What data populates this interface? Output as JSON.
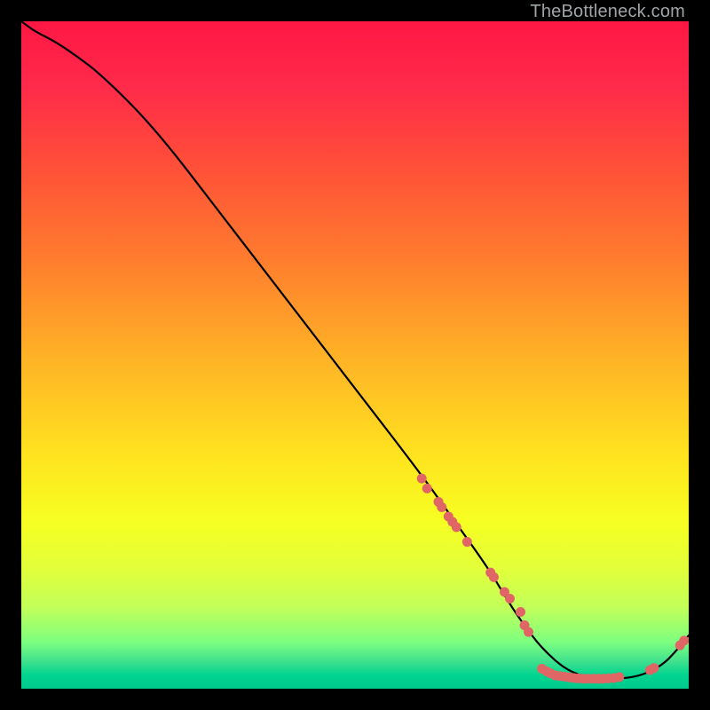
{
  "watermark": "TheBottleneck.com",
  "colors": {
    "background": "#000000",
    "curve": "#000000",
    "marker": "#e06666"
  },
  "chart_data": {
    "type": "line",
    "title": "",
    "xlabel": "",
    "ylabel": "",
    "xlim": [
      0,
      100
    ],
    "ylim": [
      0,
      100
    ],
    "grid": false,
    "series": [
      {
        "name": "bottleneck-curve",
        "x": [
          0,
          2,
          5,
          8,
          12,
          20,
          30,
          40,
          50,
          60,
          65,
          70,
          73,
          75,
          78,
          82,
          86,
          90,
          93,
          96,
          98,
          100
        ],
        "y": [
          100,
          98.5,
          97,
          95,
          92,
          84,
          71,
          58,
          45,
          32,
          25,
          18,
          13,
          10,
          6,
          2.5,
          1.5,
          1.5,
          2,
          3.5,
          5.5,
          8
        ]
      }
    ],
    "markers": [
      {
        "x": 60.0,
        "y": 31.5
      },
      {
        "x": 60.8,
        "y": 30.0
      },
      {
        "x": 62.5,
        "y": 28.0
      },
      {
        "x": 63.0,
        "y": 27.2
      },
      {
        "x": 64.0,
        "y": 25.8
      },
      {
        "x": 64.6,
        "y": 25.0
      },
      {
        "x": 65.2,
        "y": 24.2
      },
      {
        "x": 66.8,
        "y": 22.0
      },
      {
        "x": 70.3,
        "y": 17.4
      },
      {
        "x": 70.8,
        "y": 16.7
      },
      {
        "x": 72.4,
        "y": 14.5
      },
      {
        "x": 73.2,
        "y": 13.5
      },
      {
        "x": 74.8,
        "y": 11.5
      },
      {
        "x": 75.4,
        "y": 9.5
      },
      {
        "x": 76.0,
        "y": 8.5
      },
      {
        "x": 78.0,
        "y": 3.0
      },
      {
        "x": 78.7,
        "y": 2.6
      },
      {
        "x": 79.3,
        "y": 2.3
      },
      {
        "x": 80.0,
        "y": 2.0
      },
      {
        "x": 80.7,
        "y": 1.9
      },
      {
        "x": 81.4,
        "y": 1.8
      },
      {
        "x": 82.1,
        "y": 1.7
      },
      {
        "x": 82.8,
        "y": 1.6
      },
      {
        "x": 83.5,
        "y": 1.55
      },
      {
        "x": 84.2,
        "y": 1.5
      },
      {
        "x": 85.0,
        "y": 1.5
      },
      {
        "x": 85.8,
        "y": 1.5
      },
      {
        "x": 86.5,
        "y": 1.5
      },
      {
        "x": 87.2,
        "y": 1.5
      },
      {
        "x": 88.0,
        "y": 1.55
      },
      {
        "x": 88.8,
        "y": 1.6
      },
      {
        "x": 89.6,
        "y": 1.75
      },
      {
        "x": 94.2,
        "y": 2.8
      },
      {
        "x": 94.8,
        "y": 3.1
      },
      {
        "x": 98.7,
        "y": 6.5
      },
      {
        "x": 99.3,
        "y": 7.2
      }
    ]
  }
}
